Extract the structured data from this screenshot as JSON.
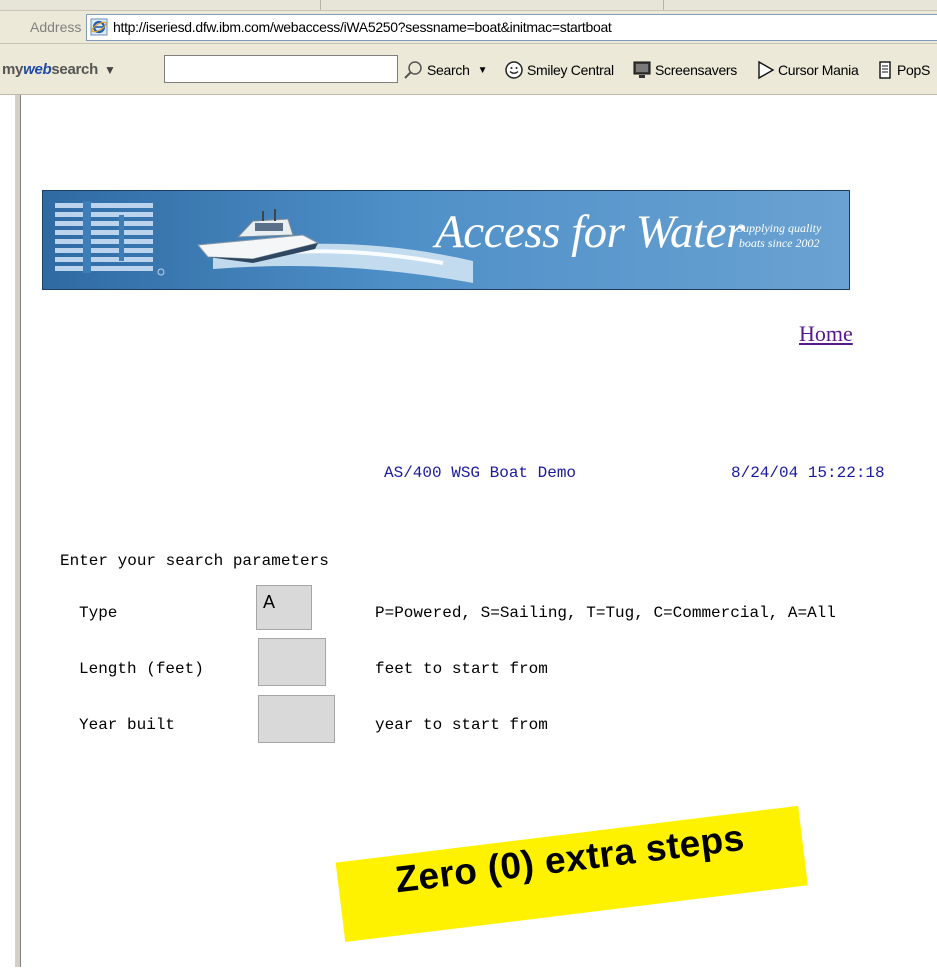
{
  "browser": {
    "address_label": "Address",
    "url": "http://iseriesd.dfw.ibm.com/webaccess/iWA5250?sessname=boat&initmac=startboat"
  },
  "toolbar": {
    "brand_prefix": "my",
    "brand_web": "web",
    "brand_suffix": "search",
    "search_label": "Search",
    "links": [
      {
        "label": "Smiley Central",
        "icon": "smiley-icon"
      },
      {
        "label": "Screensavers",
        "icon": "monitor-icon"
      },
      {
        "label": "Cursor Mania",
        "icon": "cursor-icon"
      },
      {
        "label": "PopS",
        "icon": "popup-icon"
      }
    ]
  },
  "banner": {
    "logo": "IBM",
    "title": "Access for Water",
    "subtitle": "Supplying quality\nboats since 2002",
    "colors": {
      "background": "#3f7db6"
    }
  },
  "nav": {
    "home_label": "Home"
  },
  "screen": {
    "title": "AS/400 WSG Boat Demo",
    "datetime": "8/24/04 15:22:18",
    "prompt": "Enter your search parameters",
    "fields": [
      {
        "label": "Type",
        "value": "A",
        "hint": "P=Powered, S=Sailing, T=Tug, C=Commercial, A=All"
      },
      {
        "label": "Length (feet)",
        "value": "",
        "hint": "feet to start from"
      },
      {
        "label": "Year built",
        "value": "",
        "hint": "year to start from"
      }
    ]
  },
  "callout": {
    "text": "Zero (0) extra steps",
    "color": "#fff200"
  }
}
